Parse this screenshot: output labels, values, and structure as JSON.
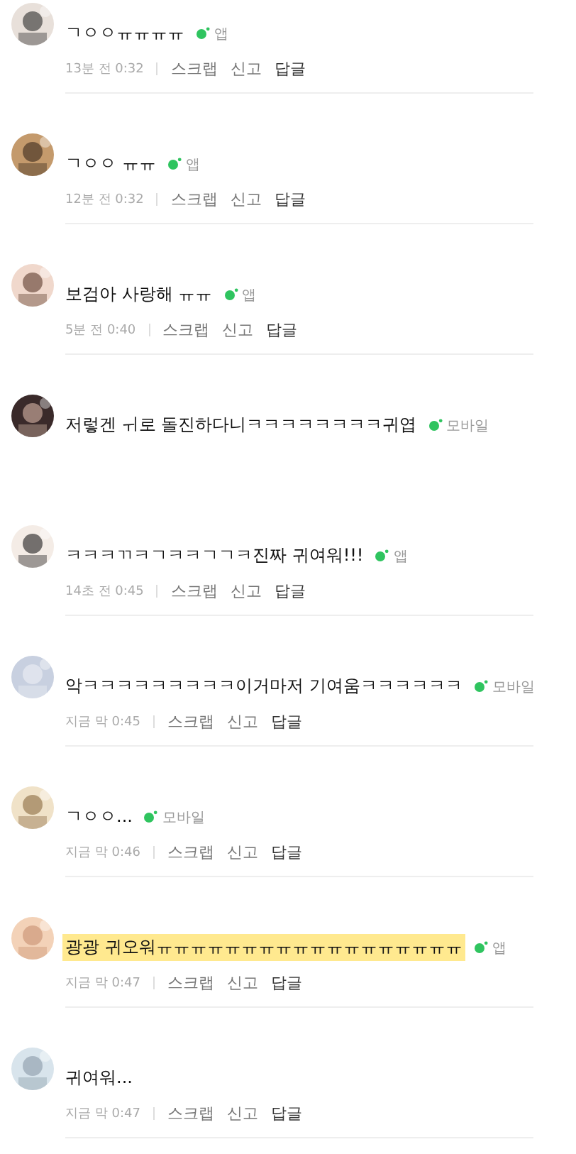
{
  "comments": [
    {
      "text": "ㄱㅇㅇㅠㅠㅠㅠ",
      "device": "앱",
      "highlighted": false,
      "meta": {
        "time": "13분 전 0:32",
        "actions": [
          "스크랩",
          "신고",
          "답글"
        ]
      }
    },
    {
      "text": "ㄱㅇㅇ ㅠㅠ",
      "device": "앱",
      "highlighted": false,
      "meta": {
        "time": "12분 전 0:32",
        "actions": [
          "스크랩",
          "신고",
          "답글"
        ]
      }
    },
    {
      "text": "보검아 사랑해 ㅠㅠ",
      "device": "앱",
      "highlighted": false,
      "meta": {
        "time": "5분 전 0:40",
        "actions": [
          "스크랩",
          "신고",
          "답글"
        ]
      }
    },
    {
      "text": "저렇겐 ㅟ로 돌진하다니ㅋㅋㅋㅋㅋㅋㅋㅋ귀엽",
      "device": "모바일",
      "highlighted": false
    },
    {
      "text": "ㅋㅋㅋㄲㅋㄱㅋㅋㄱㄱㅋ진짜 귀여워!!!",
      "device": "앱",
      "highlighted": false,
      "meta": {
        "time": "14초 전 0:45",
        "actions": [
          "스크랩",
          "신고",
          "답글"
        ]
      }
    },
    {
      "text": "악ㅋㅋㅋㅋㅋㅋㅋㅋㅋ이거마저 기여움ㅋㅋㅋㅋㅋㅋ",
      "device": "모바일",
      "highlighted": false,
      "meta": {
        "time": "지금 막 0:45",
        "actions": [
          "스크랩",
          "신고",
          "답글"
        ]
      }
    },
    {
      "text": "ㄱㅇㅇ...",
      "device": "모바일",
      "highlighted": false,
      "meta": {
        "time": "지금 막 0:46",
        "actions": [
          "스크랩",
          "신고",
          "답글"
        ]
      }
    },
    {
      "text": "광광 귀오워ㅠㅠㅠㅠㅠㅠㅠㅠㅠㅠㅠㅠㅠㅠㅠㅠㅠㅠ",
      "device": "앱",
      "highlighted": true,
      "meta": {
        "time": "지금 막 0:47",
        "actions": [
          "스크랩",
          "신고",
          "답글"
        ]
      }
    },
    {
      "text": "귀여워...",
      "highlighted": false,
      "meta": {
        "time": "지금 막 0:47",
        "actions": [
          "스크랩",
          "신고",
          "답글"
        ]
      }
    }
  ]
}
